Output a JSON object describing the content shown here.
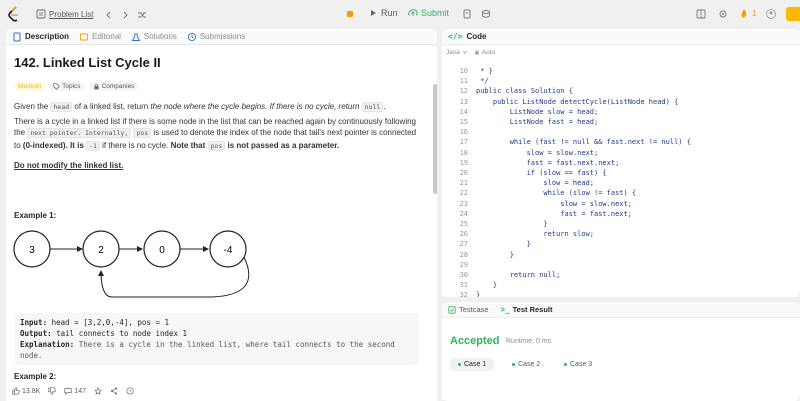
{
  "topbar": {
    "problem_list": "Problem List",
    "run": "Run",
    "submit": "Submit",
    "streak": "1"
  },
  "tabs": [
    "Description",
    "Editorial",
    "Solutions",
    "Submissions"
  ],
  "problem": {
    "title": "142. Linked List Cycle II",
    "difficulty": "Medium",
    "topics": "Topics",
    "companies": "Companies",
    "desc1_a": "Given the",
    "desc1_code": "head",
    "desc1_b": "of a linked list, return",
    "desc1_em": "the node where the cycle begins. If there is no cycle, return",
    "desc1_null": "null",
    "desc2": "There is a cycle in a linked list if there is some node in the list that can be reached again by continuously following the",
    "desc3_a": "next pointer. Internally,",
    "desc3_code": "pos",
    "desc3_b": "is used to denote the index of the node that tail's next pointer is connected to",
    "desc3_c": "(0-indexed). It is",
    "desc3_d": "-1",
    "desc3_e": "if there is no cycle.",
    "desc3_note": "Note that",
    "desc3_pos": "pos",
    "desc3_f": "is not passed as a parameter.",
    "desc4": "Do not modify the linked list.",
    "example1": "Example 1:",
    "example2": "Example 2:",
    "nodes": [
      "3",
      "2",
      "0",
      "-4"
    ],
    "input_label": "Input:",
    "input_val": "head = [3,2,0,-4], pos = 1",
    "output_label": "Output:",
    "output_val": "tail connects to node index 1",
    "expl_label": "Explanation:",
    "expl_val": "There is a cycle in the linked list, where tail connects to the second node."
  },
  "footer": {
    "likes": "13.8K",
    "comments": "147"
  },
  "code": {
    "title": "Code",
    "lang": "Java",
    "mode": "Auto",
    "lines": [
      {
        "n": "10",
        "t": " * }"
      },
      {
        "n": "11",
        "t": " */"
      },
      {
        "n": "12",
        "t": "public class Solution {"
      },
      {
        "n": "13",
        "t": "    public ListNode detectCycle(ListNode head) {"
      },
      {
        "n": "14",
        "t": "        ListNode slow = head;"
      },
      {
        "n": "15",
        "t": "        ListNode fast = head;"
      },
      {
        "n": "16",
        "t": ""
      },
      {
        "n": "17",
        "t": "        while (fast != null && fast.next != null) {"
      },
      {
        "n": "18",
        "t": "            slow = slow.next;"
      },
      {
        "n": "19",
        "t": "            fast = fast.next.next;"
      },
      {
        "n": "20",
        "t": "            if (slow == fast) {"
      },
      {
        "n": "21",
        "t": "                slow = head;"
      },
      {
        "n": "22",
        "t": "                while (slow != fast) {"
      },
      {
        "n": "23",
        "t": "                    slow = slow.next;"
      },
      {
        "n": "24",
        "t": "                    fast = fast.next;"
      },
      {
        "n": "25",
        "t": "                }"
      },
      {
        "n": "26",
        "t": "                return slow;"
      },
      {
        "n": "27",
        "t": "            }"
      },
      {
        "n": "28",
        "t": "        }"
      },
      {
        "n": "29",
        "t": ""
      },
      {
        "n": "30",
        "t": "        return null;"
      },
      {
        "n": "31",
        "t": "    }"
      },
      {
        "n": "32",
        "t": "}"
      }
    ]
  },
  "test": {
    "testcase_tab": "Testcase",
    "result_tab": "Test Result",
    "status": "Accepted",
    "runtime": "Runtime: 0 ms",
    "cases": [
      "Case 1",
      "Case 2",
      "Case 3"
    ]
  }
}
